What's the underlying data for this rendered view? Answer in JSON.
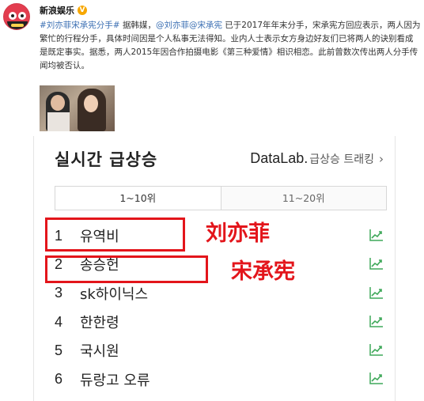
{
  "post": {
    "author": "新浪娱乐",
    "verified_icon": "V",
    "topic": "#刘亦菲宋承宪分手#",
    "text_a": " 据韩媒，",
    "mentions": "@刘亦菲@宋承宪",
    "text_b": " 已于2017年年末分手，宋承宪方回应表示，两人因为繁忙的行程分手，具体时间因是个人私事无法得知。业内人士表示女方身边好友们已将两人的诀别看成是既定事实。据悉，两人2015年因合作拍摄电影《第三种爱情》相识相恋。此前曾数次传出两人分手传闻均被否认。"
  },
  "naver": {
    "title": "실시간 급상승",
    "datalab_brand": "DataLab.",
    "datalab_text": "급상승 트래킹",
    "datalab_chevron": "›",
    "tabs": [
      "1~10위",
      "11~20위"
    ],
    "rankings": [
      {
        "rank": "1",
        "keyword": "유역비"
      },
      {
        "rank": "2",
        "keyword": "송승헌"
      },
      {
        "rank": "3",
        "keyword": "sk하이닉스"
      },
      {
        "rank": "4",
        "keyword": "한한령"
      },
      {
        "rank": "5",
        "keyword": "국시원"
      },
      {
        "rank": "6",
        "keyword": "듀랑고 오류"
      }
    ],
    "trend_icon": "trend-chart-icon",
    "accent_color": "#3fa85a"
  },
  "annotations": {
    "label_1": "刘亦菲",
    "label_2": "宋承宪",
    "color": "#e3151b"
  }
}
